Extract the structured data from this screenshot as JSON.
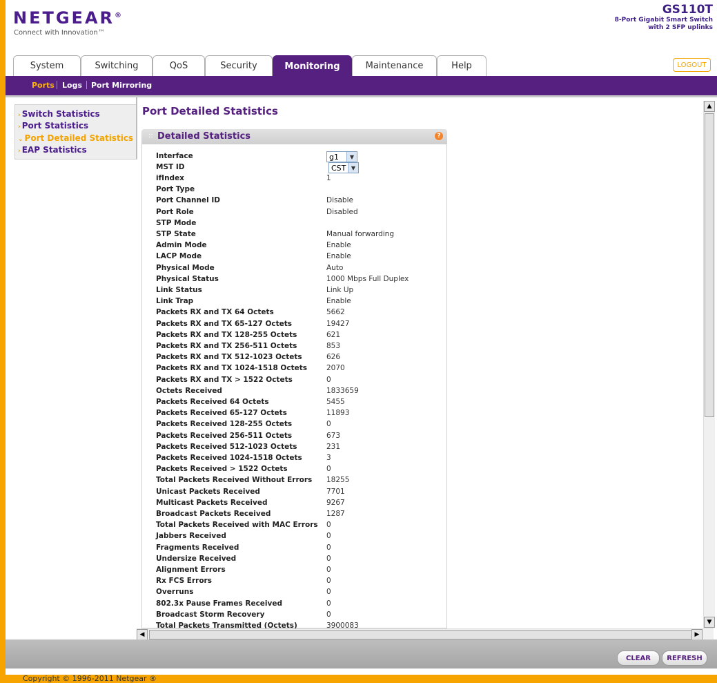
{
  "header": {
    "brand": "NETGEAR",
    "brand_mark": "®",
    "tagline": "Connect with Innovation™",
    "model": "GS110T",
    "model_desc_1": "8-Port Gigabit Smart Switch",
    "model_desc_2": "with 2 SFP uplinks",
    "logout_label": "LOGOUT"
  },
  "tabs": [
    "System",
    "Switching",
    "QoS",
    "Security",
    "Monitoring",
    "Maintenance",
    "Help"
  ],
  "active_tab": "Monitoring",
  "subnav": [
    "Ports",
    "Logs",
    "Port Mirroring"
  ],
  "leftnav": [
    "Switch Statistics",
    "Port Statistics",
    "Port Detailed Statistics",
    "EAP Statistics"
  ],
  "page_title": "Port Detailed Statistics",
  "panel_title": "Detailed Statistics",
  "help_glyph": "?",
  "interface": {
    "label": "Interface",
    "value": "g1"
  },
  "mst": {
    "label": "MST ID",
    "value": "CST"
  },
  "stats": [
    {
      "label": "ifIndex",
      "value": "1"
    },
    {
      "label": "Port Type",
      "value": ""
    },
    {
      "label": "Port Channel ID",
      "value": "Disable"
    },
    {
      "label": "Port Role",
      "value": "Disabled"
    },
    {
      "label": "STP Mode",
      "value": ""
    },
    {
      "label": "STP State",
      "value": "Manual forwarding"
    },
    {
      "label": "Admin Mode",
      "value": "Enable"
    },
    {
      "label": "LACP Mode",
      "value": "Enable"
    },
    {
      "label": "Physical Mode",
      "value": "Auto"
    },
    {
      "label": "Physical Status",
      "value": "1000 Mbps Full Duplex"
    },
    {
      "label": "Link Status",
      "value": "Link Up"
    },
    {
      "label": "Link Trap",
      "value": "Enable"
    },
    {
      "label": "Packets RX and TX 64 Octets",
      "value": "5662"
    },
    {
      "label": "Packets RX and TX 65-127 Octets",
      "value": "19427"
    },
    {
      "label": "Packets RX and TX 128-255 Octets",
      "value": "621"
    },
    {
      "label": "Packets RX and TX 256-511 Octets",
      "value": "853"
    },
    {
      "label": "Packets RX and TX 512-1023 Octets",
      "value": "626"
    },
    {
      "label": "Packets RX and TX 1024-1518 Octets",
      "value": "2070"
    },
    {
      "label": "Packets RX and TX > 1522 Octets",
      "value": "0"
    },
    {
      "label": "Octets Received",
      "value": "1833659"
    },
    {
      "label": "Packets Received 64 Octets",
      "value": "5455"
    },
    {
      "label": "Packets Received 65-127 Octets",
      "value": "11893"
    },
    {
      "label": "Packets Received 128-255 Octets",
      "value": "0"
    },
    {
      "label": "Packets Received 256-511 Octets",
      "value": "673"
    },
    {
      "label": "Packets Received 512-1023 Octets",
      "value": "231"
    },
    {
      "label": "Packets Received 1024-1518 Octets",
      "value": "3"
    },
    {
      "label": "Packets Received > 1522 Octets",
      "value": "0"
    },
    {
      "label": "Total Packets Received Without Errors",
      "value": "18255"
    },
    {
      "label": "Unicast Packets Received",
      "value": "7701"
    },
    {
      "label": "Multicast Packets Received",
      "value": "9267"
    },
    {
      "label": "Broadcast Packets Received",
      "value": "1287"
    },
    {
      "label": "Total Packets Received with MAC Errors",
      "value": "0"
    },
    {
      "label": "Jabbers Received",
      "value": "0"
    },
    {
      "label": "Fragments Received",
      "value": "0"
    },
    {
      "label": "Undersize Received",
      "value": "0"
    },
    {
      "label": "Alignment Errors",
      "value": "0"
    },
    {
      "label": "Rx FCS Errors",
      "value": "0"
    },
    {
      "label": "Overruns",
      "value": "0"
    },
    {
      "label": "802.3x Pause Frames Received",
      "value": "0"
    },
    {
      "label": "Broadcast Storm Recovery",
      "value": "0"
    },
    {
      "label": "Total Packets Transmitted (Octets)",
      "value": "3900083"
    }
  ],
  "buttons": {
    "clear": "CLEAR",
    "refresh": "REFRESH"
  },
  "copyright": "Copyright © 1996-2011 Netgear ®",
  "colors": {
    "brand_purple": "#55207f",
    "accent_orange": "#f3a400"
  }
}
